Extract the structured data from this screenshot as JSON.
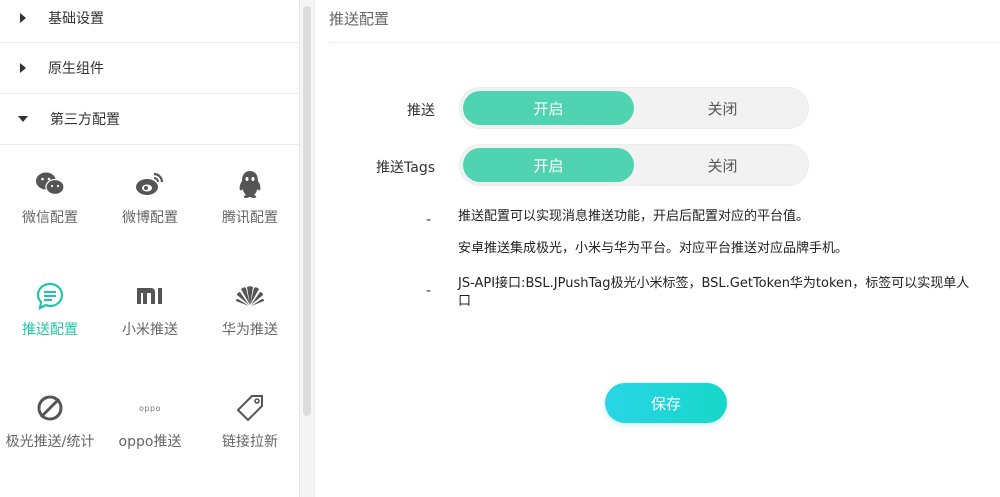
{
  "sidebar": {
    "menus": [
      {
        "label": "基础设置",
        "expanded": false
      },
      {
        "label": "原生组件",
        "expanded": false
      },
      {
        "label": "第三方配置",
        "expanded": true
      }
    ],
    "items": [
      {
        "label": "微信配置",
        "icon": "wechat-icon",
        "active": false
      },
      {
        "label": "微博配置",
        "icon": "weibo-icon",
        "active": false
      },
      {
        "label": "腾讯配置",
        "icon": "qq-icon",
        "active": false
      },
      {
        "label": "推送配置",
        "icon": "message-icon",
        "active": true
      },
      {
        "label": "小米推送",
        "icon": "xiaomi-icon",
        "active": false
      },
      {
        "label": "华为推送",
        "icon": "huawei-icon",
        "active": false
      },
      {
        "label": "极光推送/统计",
        "icon": "jiguang-icon",
        "active": false
      },
      {
        "label": "oppo推送",
        "icon": "oppo-icon",
        "active": false
      },
      {
        "label": "链接拉新",
        "icon": "tag-icon",
        "active": false
      }
    ]
  },
  "main": {
    "title": "推送配置",
    "fields": [
      {
        "label": "推送",
        "on_label": "开启",
        "off_label": "关闭",
        "value": "on"
      },
      {
        "label": "推送Tags",
        "on_label": "开启",
        "off_label": "关闭",
        "value": "on"
      }
    ],
    "notes": [
      {
        "dash": "-",
        "lines": [
          "推送配置可以实现消息推送功能，开启后配置对应的平台值。",
          "安卓推送集成极光，小米与华为平台。对应平台推送对应品牌手机。"
        ]
      },
      {
        "dash": "-",
        "lines": [
          "JS-API接口:BSL.JPushTag极光小米标签，BSL.GetToken华为token，标签可以实现单人",
          "口"
        ]
      }
    ],
    "save_label": "保存"
  },
  "colors": {
    "accent": "#4fd3b1",
    "active_text": "#1fc6a5",
    "save": "#1fd6d6"
  }
}
